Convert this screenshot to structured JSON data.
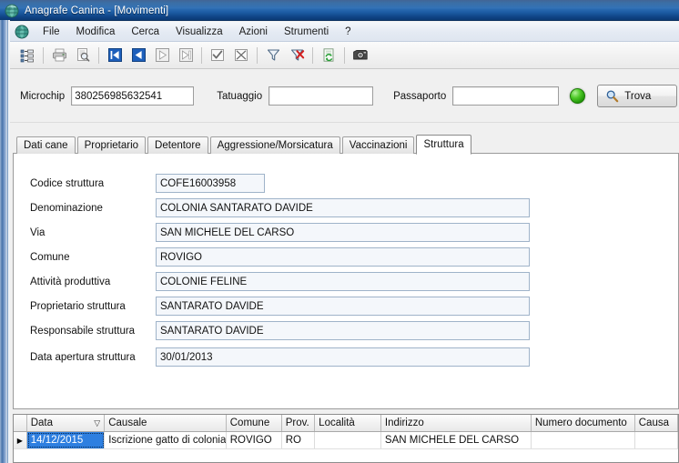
{
  "window": {
    "title": "Anagrafe Canina - [Movimenti]",
    "app_icon": "globe-icon"
  },
  "menubar": {
    "app_icon": "globe-icon",
    "items": [
      {
        "label": "File"
      },
      {
        "label": "Modifica"
      },
      {
        "label": "Cerca"
      },
      {
        "label": "Visualizza"
      },
      {
        "label": "Azioni"
      },
      {
        "label": "Strumenti"
      },
      {
        "label": "?"
      }
    ]
  },
  "toolbar": {
    "buttons": [
      {
        "icon": "tree-view-icon",
        "name": "tree-view-button"
      },
      {
        "icon": "print-icon",
        "name": "print-button"
      },
      {
        "icon": "print-preview-icon",
        "name": "print-preview-button"
      },
      {
        "icon": "first-record-icon",
        "name": "first-record-button"
      },
      {
        "icon": "previous-record-icon",
        "name": "previous-record-button"
      },
      {
        "icon": "next-record-icon",
        "name": "next-record-button"
      },
      {
        "icon": "last-record-icon",
        "name": "last-record-button"
      },
      {
        "icon": "confirm-check-icon",
        "name": "confirm-button"
      },
      {
        "icon": "cancel-x-icon",
        "name": "cancel-button"
      },
      {
        "icon": "filter-funnel-icon",
        "name": "filter-button"
      },
      {
        "icon": "filter-remove-icon",
        "name": "remove-filter-button"
      },
      {
        "icon": "refresh-document-icon",
        "name": "refresh-button"
      },
      {
        "icon": "camera-icon",
        "name": "photo-button"
      }
    ]
  },
  "search": {
    "microchip_label": "Microchip",
    "microchip_value": "380256985632541",
    "tatuaggio_label": "Tatuaggio",
    "tatuaggio_value": "",
    "passaporto_label": "Passaporto",
    "passaporto_value": "",
    "status_led_color": "#4fc929",
    "find_button_label": "Trova",
    "find_button_icon": "magnifier-icon"
  },
  "tabs": [
    {
      "label": "Dati cane",
      "active": false
    },
    {
      "label": "Proprietario",
      "active": false
    },
    {
      "label": "Detentore",
      "active": false
    },
    {
      "label": "Aggressione/Morsicatura",
      "active": false
    },
    {
      "label": "Vaccinazioni",
      "active": false
    },
    {
      "label": "Struttura",
      "active": true
    }
  ],
  "form": {
    "fields": [
      {
        "label": "Codice struttura",
        "value": "COFE16003958"
      },
      {
        "label": "Denominazione",
        "value": "COLONIA SANTARATO DAVIDE"
      },
      {
        "label": "Via",
        "value": "SAN MICHELE DEL CARSO"
      },
      {
        "label": "Comune",
        "value": "ROVIGO"
      },
      {
        "label": "Attività produttiva",
        "value": "COLONIE FELINE"
      },
      {
        "label": "Proprietario struttura",
        "value": "SANTARATO DAVIDE"
      },
      {
        "label": "Responsabile struttura",
        "value": "SANTARATO DAVIDE"
      },
      {
        "label": "Data apertura struttura",
        "value": "30/01/2013"
      }
    ]
  },
  "grid": {
    "columns": [
      {
        "label": "Data",
        "sort": "desc"
      },
      {
        "label": "Causale",
        "sort": ""
      },
      {
        "label": "Comune",
        "sort": ""
      },
      {
        "label": "Prov.",
        "sort": ""
      },
      {
        "label": "Località",
        "sort": ""
      },
      {
        "label": "Indirizzo",
        "sort": ""
      },
      {
        "label": "Numero documento",
        "sort": ""
      },
      {
        "label": "Causa",
        "sort": ""
      }
    ],
    "sort_indicator": "▽",
    "row_marker": "▶",
    "rows": [
      {
        "selected_cell": 0,
        "cells": [
          "14/12/2015",
          "Iscrizione gatto di colonia",
          "ROVIGO",
          "RO",
          "",
          "SAN MICHELE DEL CARSO",
          "",
          ""
        ]
      }
    ]
  }
}
